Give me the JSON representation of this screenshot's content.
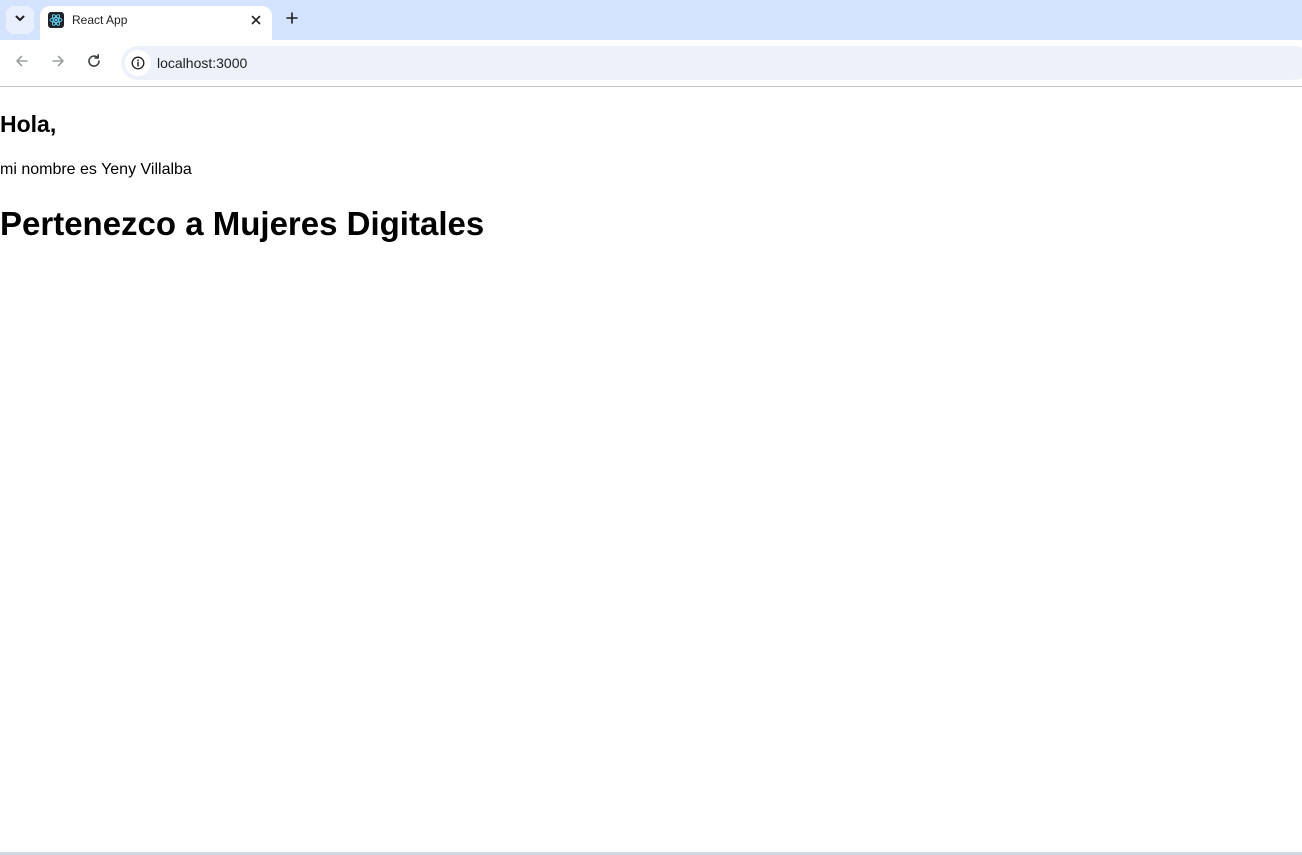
{
  "browser": {
    "tab": {
      "title": "React App",
      "favicon_icon": "react-logo-icon",
      "close_icon": "close-icon"
    },
    "tab_search_icon": "chevron-down-icon",
    "new_tab_icon": "plus-icon",
    "toolbar": {
      "back_icon": "arrow-left-icon",
      "forward_icon": "arrow-right-icon",
      "reload_icon": "reload-icon",
      "site_info_icon": "info-icon",
      "url": "localhost:3000"
    },
    "colors": {
      "tabstrip": "#d3e3fd",
      "omnibox": "#ecf1fa",
      "react_accent": "#61dafb"
    }
  },
  "page": {
    "greeting": "Hola,",
    "intro": "mi nombre es Yeny Villalba",
    "membership": "Pertenezco a Mujeres Digitales"
  }
}
